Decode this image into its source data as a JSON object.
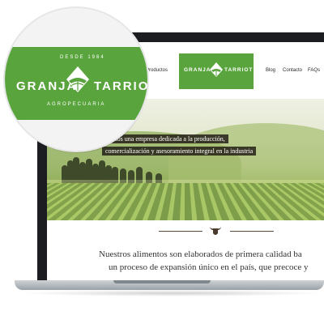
{
  "nav": {
    "productos": "Productos",
    "blog": "Blog",
    "contacto": "Contacto",
    "faqs": "FAQs"
  },
  "brand": {
    "left": "GRANJA",
    "right": "TARRIOT",
    "top_arc": "DESDE 1984",
    "bottom_arc": "AGROPECUARIA",
    "green": "#5aa43e"
  },
  "hero": {
    "line1": "Somos una empresa dedicada a la producción,",
    "line2": "comercialización y asesoramiento integral en la industria"
  },
  "content": {
    "line1": "Nuestros alimentos son elaborados de primera calidad ba",
    "line2": "un proceso de expansión único en el país, que precoce y"
  },
  "icons": [
    "farm-emblem-icon",
    "bull-head-icon"
  ]
}
